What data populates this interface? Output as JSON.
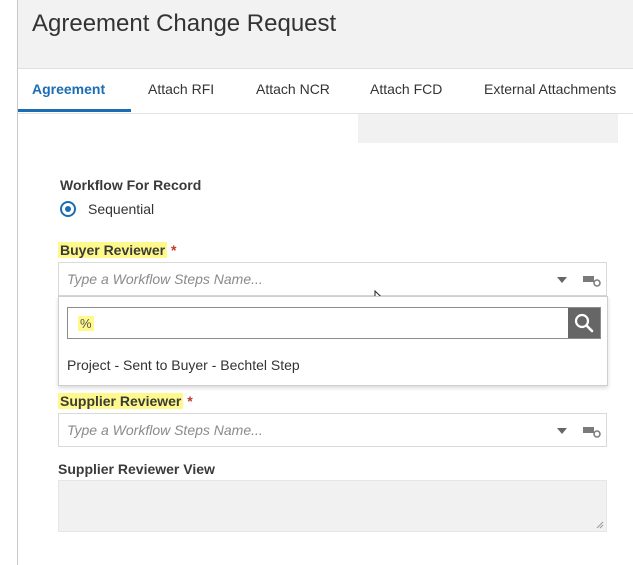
{
  "header": {
    "title": "Agreement Change Request"
  },
  "tabs": [
    {
      "label": "Agreement",
      "active": true
    },
    {
      "label": "Attach RFI"
    },
    {
      "label": "Attach NCR"
    },
    {
      "label": "Attach FCD"
    },
    {
      "label": "External Attachments"
    }
  ],
  "workflow": {
    "label": "Workflow For Record",
    "option": "Sequential"
  },
  "buyer_reviewer": {
    "label": "Buyer Reviewer",
    "required_mark": "*",
    "placeholder": "Type a Workflow Steps Name..."
  },
  "dropdown": {
    "search_value": "%",
    "options": [
      "Project - Sent to Buyer - Bechtel Step"
    ]
  },
  "supplier_reviewer": {
    "label": "Supplier Reviewer",
    "required_mark": "*",
    "placeholder": "Type a Workflow Steps Name..."
  },
  "supplier_reviewer_view": {
    "label": "Supplier Reviewer View"
  },
  "colors": {
    "accent": "#1b6db3",
    "highlight": "#fff88a",
    "required": "#c0392b"
  },
  "icons": [
    "radio-selected-icon",
    "chevron-down-icon",
    "tag-icon",
    "search-icon",
    "mouse-cursor-icon",
    "resize-grip-icon"
  ]
}
